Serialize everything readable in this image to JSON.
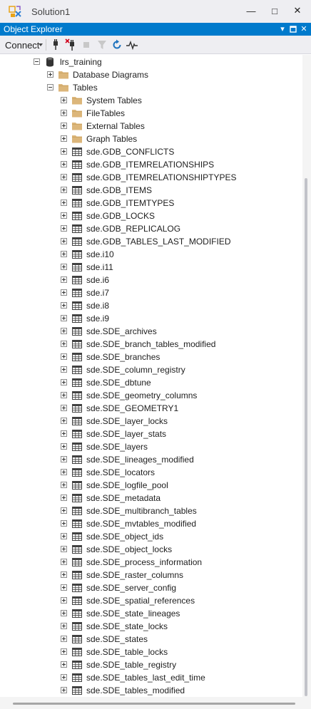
{
  "window": {
    "title": "Solution1",
    "minimize_glyph": "—",
    "maximize_glyph": "□",
    "close_glyph": "✕"
  },
  "panel": {
    "title": "Object Explorer",
    "dropdown_glyph": "▾",
    "pin_glyph": "▫",
    "close_glyph": "✕"
  },
  "toolbar": {
    "connect_label": "Connect",
    "icons": [
      "connect-plug-icon",
      "disconnect-icon",
      "stop-icon",
      "filter-icon",
      "refresh-icon",
      "activity-monitor-icon"
    ]
  },
  "colors": {
    "accent": "#007acc",
    "folder": "#dcb67a",
    "table_icon": "#424242"
  },
  "tree": {
    "database": {
      "label": "lrs_training",
      "expanded": true
    },
    "database_diagrams": {
      "label": "Database Diagrams",
      "expanded": false
    },
    "tables_folder": {
      "label": "Tables",
      "expanded": true
    },
    "folders": [
      {
        "label": "System Tables"
      },
      {
        "label": "FileTables"
      },
      {
        "label": "External Tables"
      },
      {
        "label": "Graph Tables"
      }
    ],
    "tables": [
      "sde.GDB_CONFLICTS",
      "sde.GDB_ITEMRELATIONSHIPS",
      "sde.GDB_ITEMRELATIONSHIPTYPES",
      "sde.GDB_ITEMS",
      "sde.GDB_ITEMTYPES",
      "sde.GDB_LOCKS",
      "sde.GDB_REPLICALOG",
      "sde.GDB_TABLES_LAST_MODIFIED",
      "sde.i10",
      "sde.i11",
      "sde.i6",
      "sde.i7",
      "sde.i8",
      "sde.i9",
      "sde.SDE_archives",
      "sde.SDE_branch_tables_modified",
      "sde.SDE_branches",
      "sde.SDE_column_registry",
      "sde.SDE_dbtune",
      "sde.SDE_geometry_columns",
      "sde.SDE_GEOMETRY1",
      "sde.SDE_layer_locks",
      "sde.SDE_layer_stats",
      "sde.SDE_layers",
      "sde.SDE_lineages_modified",
      "sde.SDE_locators",
      "sde.SDE_logfile_pool",
      "sde.SDE_metadata",
      "sde.SDE_multibranch_tables",
      "sde.SDE_mvtables_modified",
      "sde.SDE_object_ids",
      "sde.SDE_object_locks",
      "sde.SDE_process_information",
      "sde.SDE_raster_columns",
      "sde.SDE_server_config",
      "sde.SDE_spatial_references",
      "sde.SDE_state_lineages",
      "sde.SDE_state_locks",
      "sde.SDE_states",
      "sde.SDE_table_locks",
      "sde.SDE_table_registry",
      "sde.SDE_tables_last_edit_time",
      "sde.SDE_tables_modified"
    ]
  }
}
